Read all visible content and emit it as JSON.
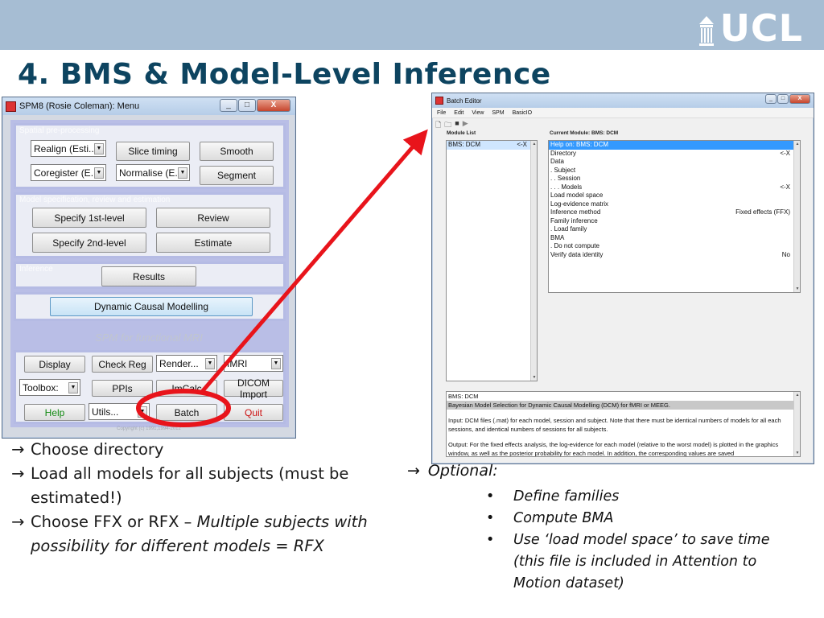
{
  "slide": {
    "title": "4. BMS & Model-Level Inference",
    "logo_text": "UCL"
  },
  "spm_window": {
    "title": "SPM8 (Rosie Coleman): Menu",
    "controls": [
      "_",
      "□",
      "X"
    ],
    "spatial": {
      "realign": "Realign (Esti...",
      "slice_timing": "Slice timing",
      "smooth": "Smooth",
      "coregister": "Coregister (E...",
      "normalise": "Normalise (E...",
      "segment": "Segment"
    },
    "model": {
      "specify_first": "Specify 1st-level",
      "review": "Review",
      "specify_second": "Specify 2nd-level",
      "estimate": "Estimate"
    },
    "inference": {
      "results": "Results"
    },
    "dcm": "Dynamic Causal Modelling",
    "label": "SPM for functional MRI",
    "utils": {
      "display": "Display",
      "check_reg": "Check Reg",
      "render": "Render...",
      "modality": "fMRI",
      "toolbox": "Toolbox:",
      "ppis": "PPIs",
      "imcalc": "ImCalc",
      "dicom": "DICOM Import",
      "help": "Help",
      "utils_sel": "Utils...",
      "batch": "Batch",
      "quit": "Quit"
    },
    "copyright": "Copyright (c) 1991,1994-2012"
  },
  "batch_editor": {
    "title": "Batch Editor",
    "menus": [
      "File",
      "Edit",
      "View",
      "SPM",
      "BasicIO"
    ],
    "module_list_label": "Module List",
    "current_module_label": "Current Module: BMS: DCM",
    "modules": [
      {
        "name": "BMS: DCM",
        "value": "<-X"
      }
    ],
    "fields": [
      {
        "name": "Help on: BMS: DCM",
        "value": ""
      },
      {
        "name": "Directory",
        "value": "<-X"
      },
      {
        "name": "Data",
        "value": ""
      },
      {
        "name": ". Subject",
        "value": ""
      },
      {
        "name": ". . Session",
        "value": ""
      },
      {
        "name": ". . . Models",
        "value": "<-X"
      },
      {
        "name": "Load model space",
        "value": ""
      },
      {
        "name": "Log-evidence matrix",
        "value": ""
      },
      {
        "name": "Inference method",
        "value": "Fixed effects (FFX)"
      },
      {
        "name": "Family inference",
        "value": ""
      },
      {
        "name": ". Load family",
        "value": ""
      },
      {
        "name": "BMA",
        "value": ""
      },
      {
        "name": ". Do not compute",
        "value": ""
      },
      {
        "name": "Verify data identity",
        "value": "No"
      }
    ],
    "description": [
      "BMS: DCM",
      "Bayesian Model Selection for Dynamic Causal Modelling (DCM) for fMRI or MEEG.",
      "",
      "Input:  DCM  files  (.mat) for each model, session and subject. Note that there must be identical numbers of models for all each sessions, and identical numbers of sessions for all subjects.",
      "",
      "Output:  For  the  fixed  effects  analysis,  the log-evidence for each model (relative to the worst model) is plotted in the graphics  window,  as well as the posterior probability for each model. In addition, the corresponding values are saved"
    ]
  },
  "notes": {
    "left": [
      {
        "arrow": "→",
        "text": "Choose directory"
      },
      {
        "arrow": "→",
        "text": "Load all models for all subjects (must be estimated!)"
      },
      {
        "arrow": "→",
        "text_plain": "Choose FFX or RFX – ",
        "text_italic": "Multiple subjects with possibility for different models  =  RFX"
      }
    ],
    "optional_arrow": "→",
    "optional_label": "Optional:",
    "optional_items": [
      "Define families",
      "Compute BMA",
      "Use ‘load model space’ to save time (this file is included in Attention to Motion dataset)"
    ]
  },
  "colors": {
    "header_bar": "#a6bdd3",
    "title": "#0d4460",
    "panel_border": "#b5bbe4",
    "highlight_red": "#e8141b",
    "list_highlight": "#3399ff"
  }
}
